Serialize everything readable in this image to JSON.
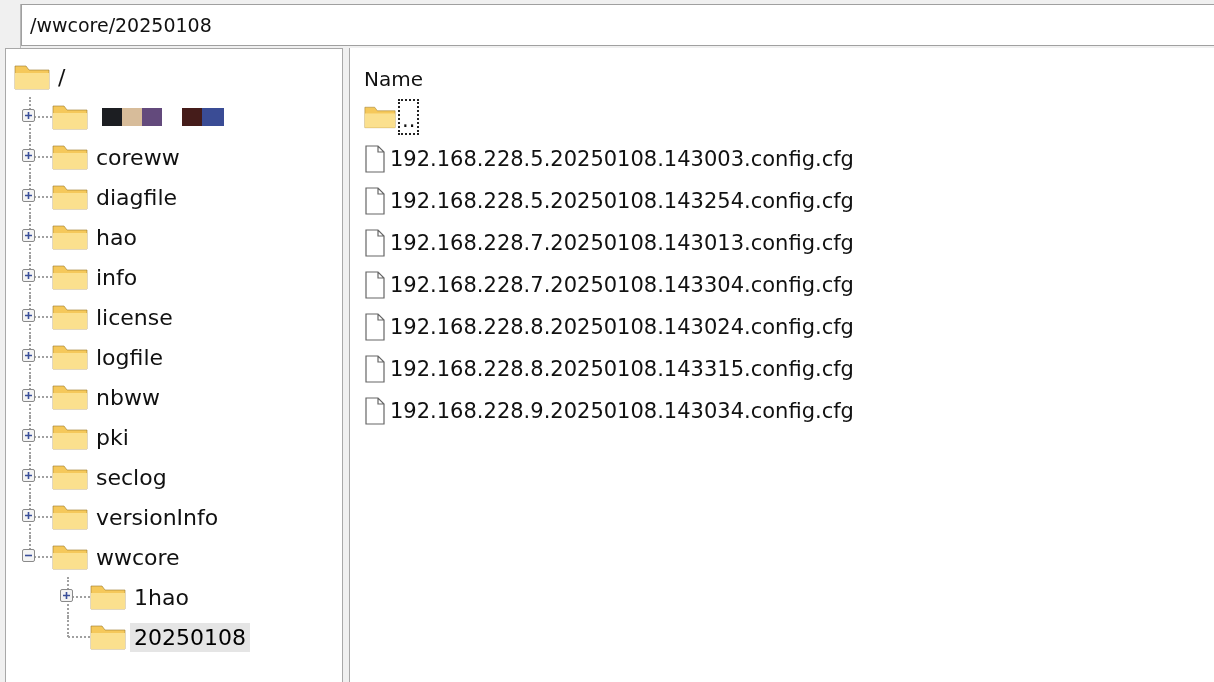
{
  "address_bar": {
    "value": "/wwcore/20250108"
  },
  "tree": {
    "label": "/",
    "children": [
      {
        "kind": "redacted",
        "expanded": false
      },
      {
        "kind": "folder",
        "label": "coreww",
        "expanded": false,
        "selected": false
      },
      {
        "kind": "folder",
        "label": "diagfile",
        "expanded": false,
        "selected": false
      },
      {
        "kind": "folder",
        "label": "hao",
        "expanded": false,
        "selected": false
      },
      {
        "kind": "folder",
        "label": "info",
        "expanded": false,
        "selected": false
      },
      {
        "kind": "folder",
        "label": "license",
        "expanded": false,
        "selected": false
      },
      {
        "kind": "folder",
        "label": "logfile",
        "expanded": false,
        "selected": false
      },
      {
        "kind": "folder",
        "label": "nbww",
        "expanded": false,
        "selected": false
      },
      {
        "kind": "folder",
        "label": "pki",
        "expanded": false,
        "selected": false
      },
      {
        "kind": "folder",
        "label": "seclog",
        "expanded": false,
        "selected": false
      },
      {
        "kind": "folder",
        "label": "versionInfo",
        "expanded": false,
        "selected": false
      },
      {
        "kind": "folder",
        "label": "wwcore",
        "expanded": true,
        "selected": false,
        "children": [
          {
            "kind": "folder",
            "label": "1hao",
            "expanded": false,
            "selected": false
          },
          {
            "kind": "leaf",
            "label": "20250108",
            "selected": true
          }
        ]
      }
    ]
  },
  "file_list": {
    "columns": [
      "Name"
    ],
    "rows": [
      {
        "kind": "parent",
        "name": "..",
        "focused": true
      },
      {
        "kind": "file",
        "name": "192.168.228.5.20250108.143003.config.cfg"
      },
      {
        "kind": "file",
        "name": "192.168.228.5.20250108.143254.config.cfg"
      },
      {
        "kind": "file",
        "name": "192.168.228.7.20250108.143013.config.cfg"
      },
      {
        "kind": "file",
        "name": "192.168.228.7.20250108.143304.config.cfg"
      },
      {
        "kind": "file",
        "name": "192.168.228.8.20250108.143024.config.cfg"
      },
      {
        "kind": "file",
        "name": "192.168.228.8.20250108.143315.config.cfg"
      },
      {
        "kind": "file",
        "name": "192.168.228.9.20250108.143034.config.cfg"
      }
    ]
  }
}
